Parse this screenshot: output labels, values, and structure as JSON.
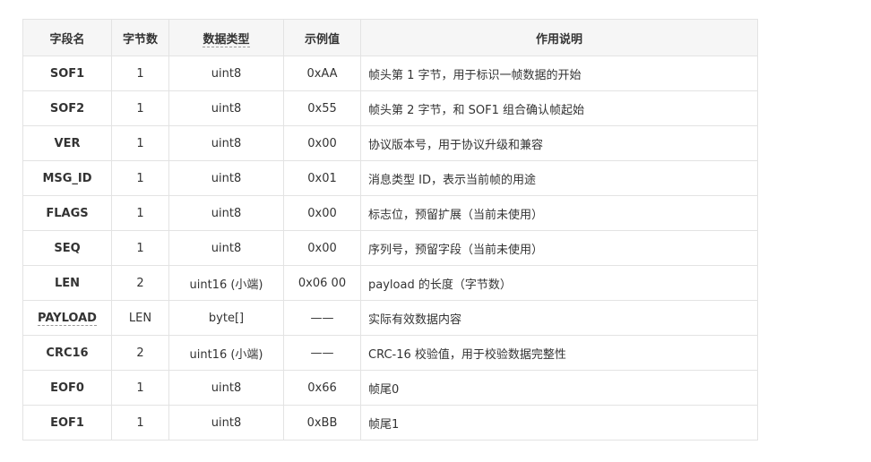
{
  "table": {
    "headers": [
      "字段名",
      "字节数",
      "数据类型",
      "示例值",
      "作用说明"
    ],
    "rows": [
      {
        "field": "SOF1",
        "bytes": "1",
        "type": "uint8",
        "example": "0xAA",
        "desc": "帧头第 1 字节，用于标识一帧数据的开始"
      },
      {
        "field": "SOF2",
        "bytes": "1",
        "type": "uint8",
        "example": "0x55",
        "desc": "帧头第 2 字节，和 SOF1 组合确认帧起始"
      },
      {
        "field": "VER",
        "bytes": "1",
        "type": "uint8",
        "example": "0x00",
        "desc": "协议版本号，用于协议升级和兼容"
      },
      {
        "field": "MSG_ID",
        "bytes": "1",
        "type": "uint8",
        "example": "0x01",
        "desc": "消息类型 ID，表示当前帧的用途"
      },
      {
        "field": "FLAGS",
        "bytes": "1",
        "type": "uint8",
        "example": "0x00",
        "desc": "标志位，预留扩展（当前未使用）"
      },
      {
        "field": "SEQ",
        "bytes": "1",
        "type": "uint8",
        "example": "0x00",
        "desc": "序列号，预留字段（当前未使用）"
      },
      {
        "field": "LEN",
        "bytes": "2",
        "type": "uint16 (小端)",
        "example": "0x06 00",
        "desc": "payload 的长度（字节数）"
      },
      {
        "field": "PAYLOAD",
        "bytes": "LEN",
        "type": "byte[]",
        "example": "——",
        "desc": "实际有效数据内容"
      },
      {
        "field": "CRC16",
        "bytes": "2",
        "type": "uint16 (小端)",
        "example": "——",
        "desc": "CRC-16 校验值，用于校验数据完整性"
      },
      {
        "field": "EOF0",
        "bytes": "1",
        "type": "uint8",
        "example": "0x66",
        "desc": "帧尾0"
      },
      {
        "field": "EOF1",
        "bytes": "1",
        "type": "uint8",
        "example": "0xBB",
        "desc": "帧尾1"
      }
    ]
  }
}
